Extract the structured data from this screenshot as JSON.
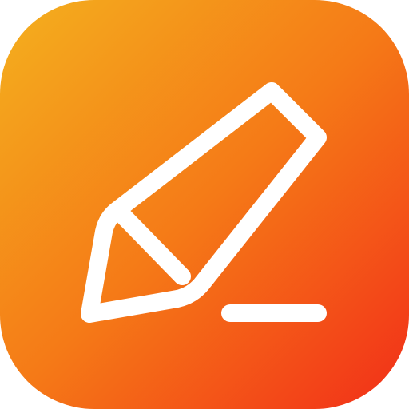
{
  "app_icon": {
    "icon": "pencil-edit-icon",
    "background_gradient": {
      "start": "#F4B01E",
      "mid": "#F57A17",
      "end": "#F22E18"
    },
    "glyph_color": "#FFFFFF"
  }
}
